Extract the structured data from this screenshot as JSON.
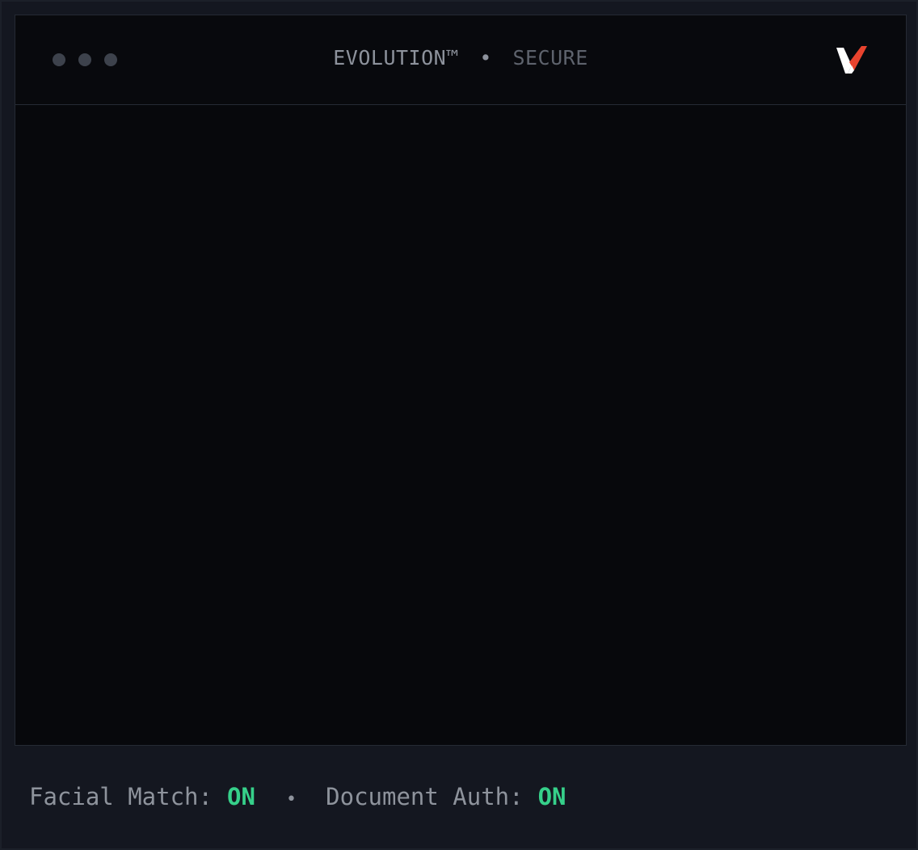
{
  "window": {
    "title_primary": "EVOLUTION™",
    "title_separator": "•",
    "title_secondary": "SECURE",
    "logo_icon": "v-check-logo-icon",
    "controls": [
      "window-dot-icon",
      "window-dot-icon",
      "window-dot-icon"
    ]
  },
  "status_bar": {
    "facial_match_label": "Facial Match:",
    "facial_match_value": "ON",
    "separator": "•",
    "document_auth_label": "Document Auth:",
    "document_auth_value": "ON"
  },
  "colors": {
    "background": "#141720",
    "window_background": "#07080c",
    "status_on": "#36d08a",
    "logo_accent": "#e8432e",
    "logo_main": "#ffffff"
  }
}
